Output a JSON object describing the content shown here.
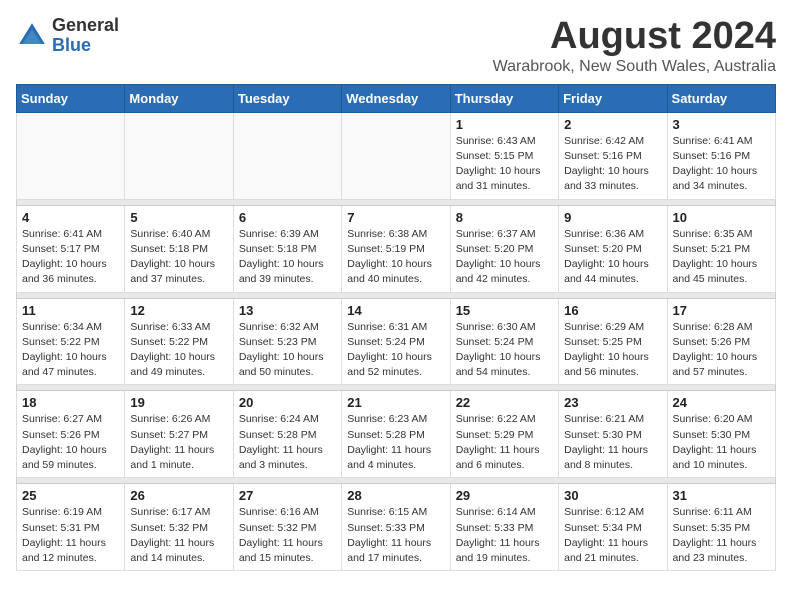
{
  "header": {
    "logo_general": "General",
    "logo_blue": "Blue",
    "month_year": "August 2024",
    "location": "Warabrook, New South Wales, Australia"
  },
  "weekdays": [
    "Sunday",
    "Monday",
    "Tuesday",
    "Wednesday",
    "Thursday",
    "Friday",
    "Saturday"
  ],
  "weeks": [
    [
      {
        "day": "",
        "info": ""
      },
      {
        "day": "",
        "info": ""
      },
      {
        "day": "",
        "info": ""
      },
      {
        "day": "",
        "info": ""
      },
      {
        "day": "1",
        "info": "Sunrise: 6:43 AM\nSunset: 5:15 PM\nDaylight: 10 hours\nand 31 minutes."
      },
      {
        "day": "2",
        "info": "Sunrise: 6:42 AM\nSunset: 5:16 PM\nDaylight: 10 hours\nand 33 minutes."
      },
      {
        "day": "3",
        "info": "Sunrise: 6:41 AM\nSunset: 5:16 PM\nDaylight: 10 hours\nand 34 minutes."
      }
    ],
    [
      {
        "day": "4",
        "info": "Sunrise: 6:41 AM\nSunset: 5:17 PM\nDaylight: 10 hours\nand 36 minutes."
      },
      {
        "day": "5",
        "info": "Sunrise: 6:40 AM\nSunset: 5:18 PM\nDaylight: 10 hours\nand 37 minutes."
      },
      {
        "day": "6",
        "info": "Sunrise: 6:39 AM\nSunset: 5:18 PM\nDaylight: 10 hours\nand 39 minutes."
      },
      {
        "day": "7",
        "info": "Sunrise: 6:38 AM\nSunset: 5:19 PM\nDaylight: 10 hours\nand 40 minutes."
      },
      {
        "day": "8",
        "info": "Sunrise: 6:37 AM\nSunset: 5:20 PM\nDaylight: 10 hours\nand 42 minutes."
      },
      {
        "day": "9",
        "info": "Sunrise: 6:36 AM\nSunset: 5:20 PM\nDaylight: 10 hours\nand 44 minutes."
      },
      {
        "day": "10",
        "info": "Sunrise: 6:35 AM\nSunset: 5:21 PM\nDaylight: 10 hours\nand 45 minutes."
      }
    ],
    [
      {
        "day": "11",
        "info": "Sunrise: 6:34 AM\nSunset: 5:22 PM\nDaylight: 10 hours\nand 47 minutes."
      },
      {
        "day": "12",
        "info": "Sunrise: 6:33 AM\nSunset: 5:22 PM\nDaylight: 10 hours\nand 49 minutes."
      },
      {
        "day": "13",
        "info": "Sunrise: 6:32 AM\nSunset: 5:23 PM\nDaylight: 10 hours\nand 50 minutes."
      },
      {
        "day": "14",
        "info": "Sunrise: 6:31 AM\nSunset: 5:24 PM\nDaylight: 10 hours\nand 52 minutes."
      },
      {
        "day": "15",
        "info": "Sunrise: 6:30 AM\nSunset: 5:24 PM\nDaylight: 10 hours\nand 54 minutes."
      },
      {
        "day": "16",
        "info": "Sunrise: 6:29 AM\nSunset: 5:25 PM\nDaylight: 10 hours\nand 56 minutes."
      },
      {
        "day": "17",
        "info": "Sunrise: 6:28 AM\nSunset: 5:26 PM\nDaylight: 10 hours\nand 57 minutes."
      }
    ],
    [
      {
        "day": "18",
        "info": "Sunrise: 6:27 AM\nSunset: 5:26 PM\nDaylight: 10 hours\nand 59 minutes."
      },
      {
        "day": "19",
        "info": "Sunrise: 6:26 AM\nSunset: 5:27 PM\nDaylight: 11 hours\nand 1 minute."
      },
      {
        "day": "20",
        "info": "Sunrise: 6:24 AM\nSunset: 5:28 PM\nDaylight: 11 hours\nand 3 minutes."
      },
      {
        "day": "21",
        "info": "Sunrise: 6:23 AM\nSunset: 5:28 PM\nDaylight: 11 hours\nand 4 minutes."
      },
      {
        "day": "22",
        "info": "Sunrise: 6:22 AM\nSunset: 5:29 PM\nDaylight: 11 hours\nand 6 minutes."
      },
      {
        "day": "23",
        "info": "Sunrise: 6:21 AM\nSunset: 5:30 PM\nDaylight: 11 hours\nand 8 minutes."
      },
      {
        "day": "24",
        "info": "Sunrise: 6:20 AM\nSunset: 5:30 PM\nDaylight: 11 hours\nand 10 minutes."
      }
    ],
    [
      {
        "day": "25",
        "info": "Sunrise: 6:19 AM\nSunset: 5:31 PM\nDaylight: 11 hours\nand 12 minutes."
      },
      {
        "day": "26",
        "info": "Sunrise: 6:17 AM\nSunset: 5:32 PM\nDaylight: 11 hours\nand 14 minutes."
      },
      {
        "day": "27",
        "info": "Sunrise: 6:16 AM\nSunset: 5:32 PM\nDaylight: 11 hours\nand 15 minutes."
      },
      {
        "day": "28",
        "info": "Sunrise: 6:15 AM\nSunset: 5:33 PM\nDaylight: 11 hours\nand 17 minutes."
      },
      {
        "day": "29",
        "info": "Sunrise: 6:14 AM\nSunset: 5:33 PM\nDaylight: 11 hours\nand 19 minutes."
      },
      {
        "day": "30",
        "info": "Sunrise: 6:12 AM\nSunset: 5:34 PM\nDaylight: 11 hours\nand 21 minutes."
      },
      {
        "day": "31",
        "info": "Sunrise: 6:11 AM\nSunset: 5:35 PM\nDaylight: 11 hours\nand 23 minutes."
      }
    ]
  ]
}
